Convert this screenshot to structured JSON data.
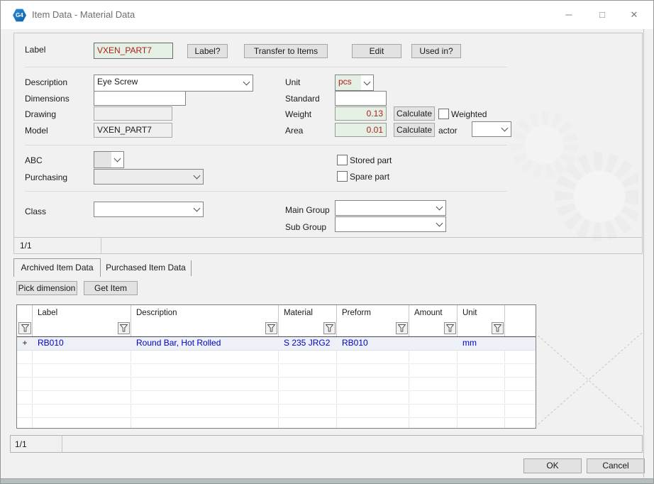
{
  "window": {
    "title": "Item Data - Material Data",
    "icon_text": "G4",
    "minimize_glyph": "─",
    "maximize_glyph": "□",
    "close_glyph": "✕"
  },
  "header": {
    "label_caption": "Label",
    "label_value": "VXEN_PART7",
    "label_button": "Label?",
    "transfer_button": "Transfer to Items",
    "edit_button": "Edit",
    "used_in_button": "Used in?"
  },
  "form": {
    "description_label": "Description",
    "description_value": "Eye Screw",
    "dimensions_label": "Dimensions",
    "dimensions_value": "",
    "drawing_label": "Drawing",
    "drawing_value": "",
    "model_label": "Model",
    "model_value": "VXEN_PART7",
    "unit_label": "Unit",
    "unit_value": "pcs",
    "standard_label": "Standard",
    "standard_value": "",
    "weight_label": "Weight",
    "weight_value": "0.13",
    "weight_calculate_button": "Calculate",
    "weighted_checkbox_label": "Weighted",
    "area_label": "Area",
    "area_value": "0.01",
    "area_calculate_button": "Calculate",
    "factor_label": "actor",
    "abc_label": "ABC",
    "purchasing_label": "Purchasing",
    "stored_part_checkbox_label": "Stored part",
    "spare_part_checkbox_label": "Spare part",
    "class_label": "Class",
    "main_group_label": "Main Group",
    "sub_group_label": "Sub Group",
    "record_indicator": "1/1"
  },
  "tabs": {
    "archived": "Archived Item Data",
    "purchased": "Purchased Item Data"
  },
  "toolbar": {
    "pick_dimension_button": "Pick dimension",
    "get_item_button": "Get Item"
  },
  "table": {
    "columns": [
      "Label",
      "Description",
      "Material",
      "Preform",
      "Amount",
      "Unit"
    ],
    "rows": [
      {
        "expand": "+",
        "label": "RB010",
        "description": "Round Bar, Hot Rolled",
        "material": "S 235 JRG2",
        "preform": "RB010",
        "amount": "",
        "unit": "mm"
      }
    ],
    "record_indicator": "1/1"
  },
  "footer": {
    "ok_button": "OK",
    "cancel_button": "Cancel"
  },
  "colors": {
    "field_green": "#e3f0e3",
    "value_red": "#b01c1c",
    "data_blue": "#0000c8",
    "bottom_strip": "#b3bfc0"
  }
}
